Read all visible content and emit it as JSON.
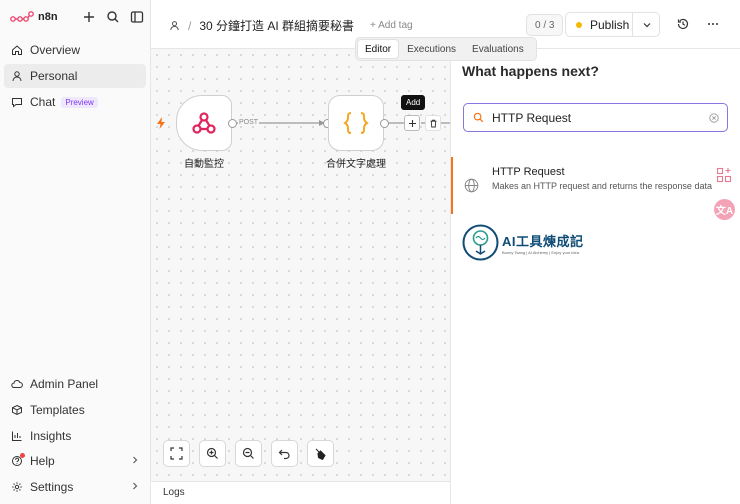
{
  "app": {
    "name": "n8n"
  },
  "sidebar": {
    "top_items": [
      {
        "label": "Overview",
        "icon": "home-icon"
      },
      {
        "label": "Personal",
        "icon": "user-icon",
        "active": true
      },
      {
        "label": "Chat",
        "icon": "chat-icon",
        "badge": "Preview"
      }
    ],
    "bottom_items": [
      {
        "label": "Admin Panel",
        "icon": "cloud-icon"
      },
      {
        "label": "Templates",
        "icon": "box-icon"
      },
      {
        "label": "Insights",
        "icon": "chart-icon"
      },
      {
        "label": "Help",
        "icon": "help-icon"
      },
      {
        "label": "Settings",
        "icon": "gear-icon"
      }
    ]
  },
  "header": {
    "workflow_title": "30 分鐘打造 AI 群組摘要秘書",
    "add_tag": "+ Add tag",
    "counter": "0 / 3",
    "publish_label": "Publish"
  },
  "tabs": [
    "Editor",
    "Executions",
    "Evaluations"
  ],
  "canvas": {
    "nodes": [
      {
        "label": "自動監控"
      },
      {
        "label": "合併文字處理"
      }
    ],
    "connection_label": "POST",
    "add_tooltip": "Add",
    "logs_label": "Logs"
  },
  "panel": {
    "title": "What happens next?",
    "search_value": "HTTP Request",
    "result": {
      "title": "HTTP Request",
      "description": "Makes an HTTP request and returns the response data"
    },
    "brand": {
      "main": "AI工具煉成記",
      "sub": "Bunny Tsang | AI Alchemy | Enjoy your idea"
    }
  },
  "colors": {
    "accent": "#8b73e0",
    "publish_dot": "#f5b800",
    "active_bar": "#f97316",
    "webhook": "#e0245e",
    "code": "#f5a623"
  }
}
